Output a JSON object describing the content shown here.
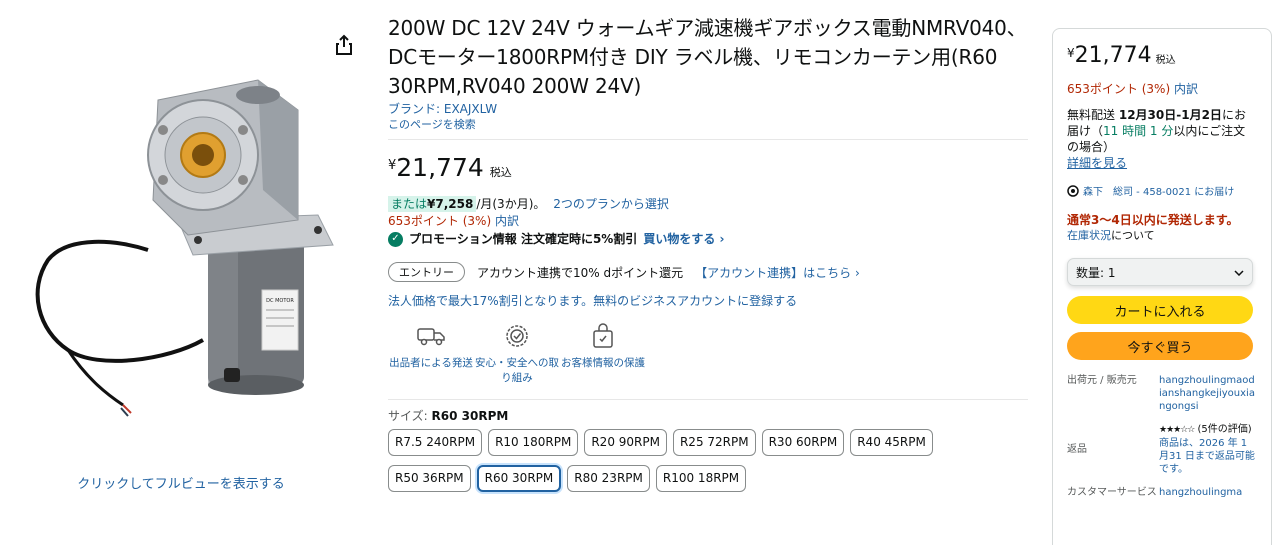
{
  "gallery": {
    "full_view_label": "クリックしてフルビューを表示する",
    "share_icon": "share-icon",
    "image_icon": "gear-motor-image",
    "label_text": "DC MOTOR"
  },
  "product": {
    "title": "200W DC 12V 24V ウォームギア減速機ギアボックス電動NMRV040、DCモーター1800RPM付き DIY ラベル機、リモコンカーテン用(R60 30RPM,RV040 200W 24V)",
    "brand": "ブランド: EXAJXLW",
    "search_page": "このページを検索",
    "price_symbol": "¥",
    "price": "21,774",
    "tax": "税込",
    "installment_prefix": "または",
    "installment_amount": "¥7,258",
    "installment_suffix": "/月(3か月)。",
    "installment_plans": "2つのプランから選択",
    "points": "653ポイント (3%)",
    "points_breakdown": "内訳",
    "promo_label": "プロモーション情報 注文確定時に5%割引",
    "promo_shop": "買い物をする",
    "entry_pill": "エントリー",
    "entry_text": "アカウント連携で10% dポイント還元",
    "entry_link": "【アカウント連携】はこちら",
    "business": "法人価格で最大17%割引となります。無料のビジネスアカウントに登録する",
    "trust": [
      {
        "icon": "delivery-truck-icon",
        "label": "出品者による発送"
      },
      {
        "icon": "safety-badge-icon",
        "label": "安心・安全への取り組み"
      },
      {
        "icon": "secure-bag-icon",
        "label": "お客様情報の保護"
      }
    ],
    "size_label": "サイズ:",
    "size_selected": "R60 30RPM",
    "sizes": [
      "R7.5 240RPM",
      "R10 180RPM",
      "R20 90RPM",
      "R25 72RPM",
      "R30 60RPM",
      "R40 45RPM",
      "R50 36RPM",
      "R60 30RPM",
      "R80 23RPM",
      "R100 18RPM"
    ]
  },
  "buybox": {
    "price_symbol": "¥",
    "price": "21,774",
    "tax": "税込",
    "points": "653ポイント (3%)",
    "points_breakdown": "内訳",
    "delivery_prefix": "無料配送",
    "delivery_dates": "12月30日-1月2日",
    "delivery_mid": "にお届け（",
    "delivery_countdown": "11 時間 1 分",
    "delivery_suffix": "以内にご注文の場合）",
    "details_link": "詳細を見る",
    "location": "森下　総司 - 458-0021 にお届け",
    "ship_notice": "通常3～4日以内に発送します。",
    "stock_link": "在庫状況",
    "stock_suffix": "について",
    "quantity": "数量: 1",
    "add_to_cart": "カートに入れる",
    "buy_now": "今すぐ買う",
    "seller_key": "出荷元 / 販売元",
    "seller_value": "hangzhoulingmaodianshangkejiyouxiangongsi",
    "rating_stars": "★★★☆☆",
    "rating_count": "(5件の評価)",
    "return_key": "返品",
    "return_value": "商品は、2026 年 1 月31 日まで返品可能です。",
    "cs_key": "カスタマーサービス",
    "cs_value": "hangzhoulingma"
  },
  "colors": {
    "link": "#2162a1",
    "price_red": "#b12704",
    "green": "#067d62",
    "cart_yellow": "#ffd814",
    "buy_orange": "#ffa41c"
  }
}
